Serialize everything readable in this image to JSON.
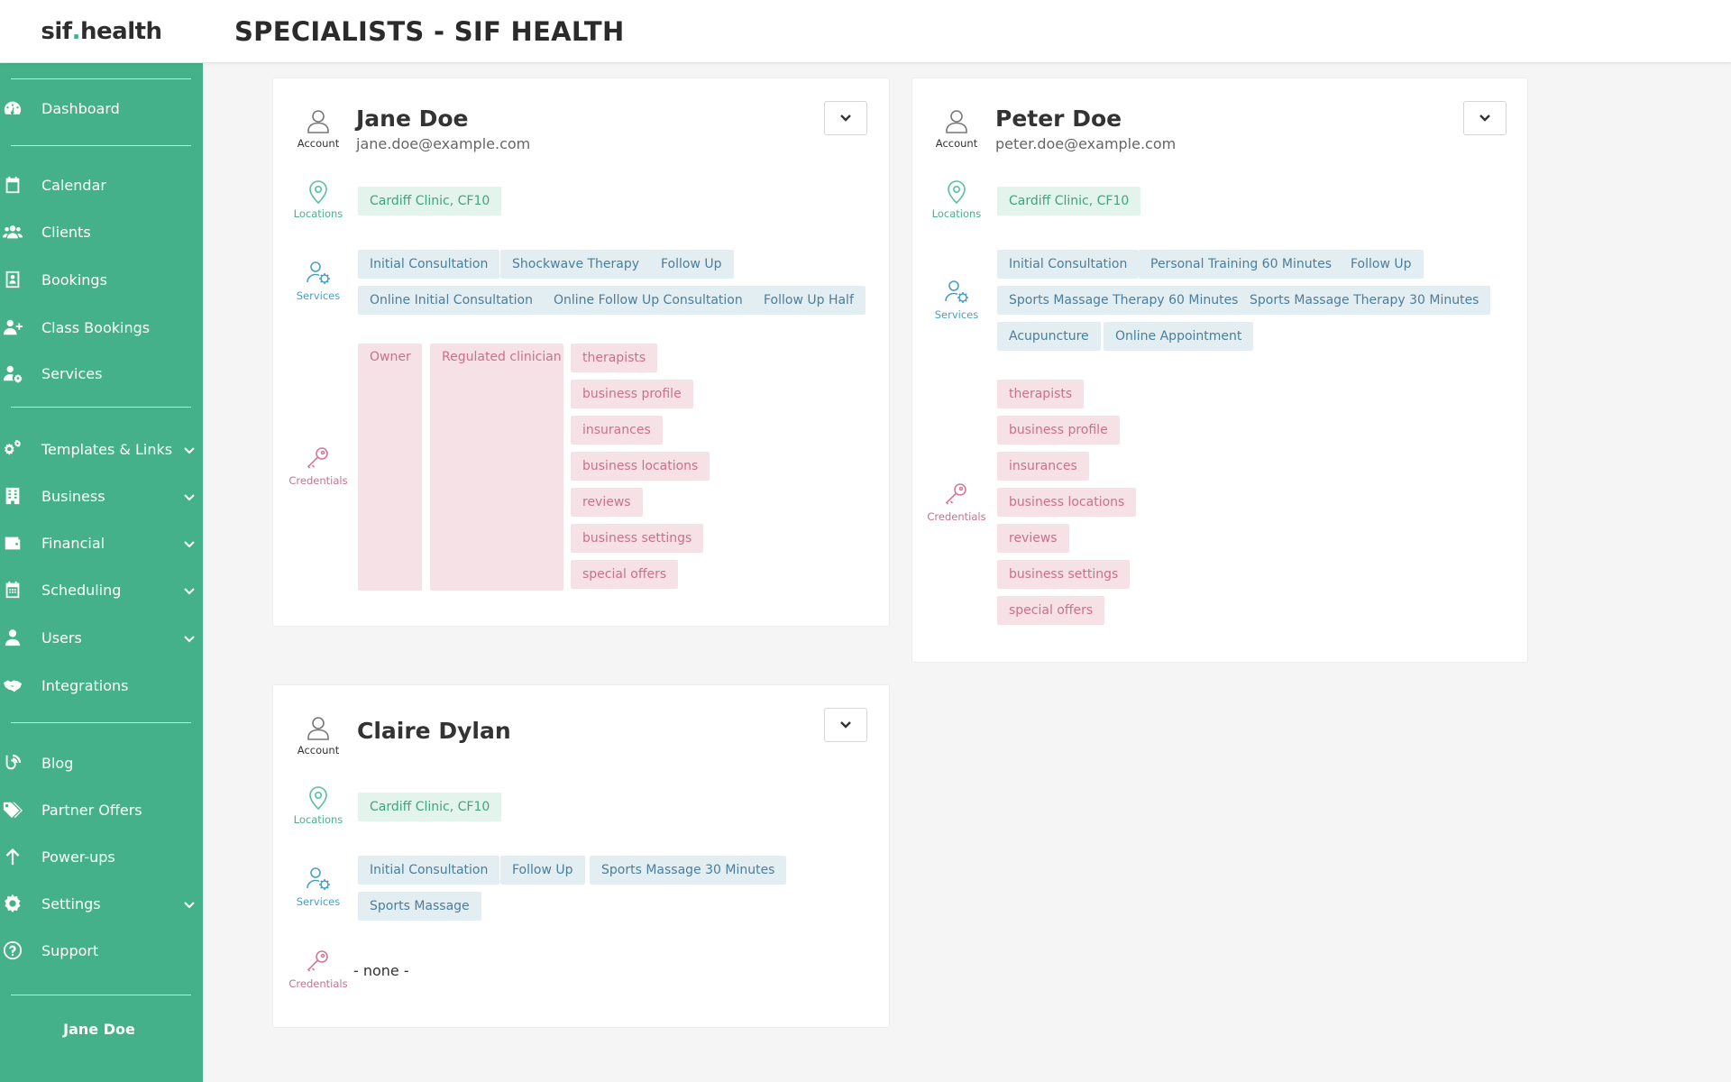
{
  "app": {
    "logo_left": "sif",
    "logo_dot": ".",
    "logo_right": "health",
    "page_title": "SPECIALISTS - SIF HEALTH",
    "accent_color": "#45b18b"
  },
  "sidebar": {
    "items": [
      {
        "label": "Dashboard",
        "icon": "dashboard-icon"
      },
      {
        "label": "Calendar",
        "icon": "calendar-icon"
      },
      {
        "label": "Clients",
        "icon": "users-icon"
      },
      {
        "label": "Bookings",
        "icon": "bookings-icon"
      },
      {
        "label": "Class Bookings",
        "icon": "user-plus-icon"
      },
      {
        "label": "Services",
        "icon": "user-gear-icon"
      },
      {
        "label": "Templates & Links",
        "icon": "gears-icon"
      },
      {
        "label": "Business",
        "icon": "building-icon"
      },
      {
        "label": "Financial",
        "icon": "wallet-icon"
      },
      {
        "label": "Scheduling",
        "icon": "calendar-grid-icon"
      },
      {
        "label": "Users",
        "icon": "user-tie-icon"
      },
      {
        "label": "Integrations",
        "icon": "handshake-icon"
      },
      {
        "label": "Blog",
        "icon": "blog-icon"
      },
      {
        "label": "Partner Offers",
        "icon": "tags-icon"
      },
      {
        "label": "Power-ups",
        "icon": "arrow-up-icon"
      },
      {
        "label": "Settings",
        "icon": "gear-icon"
      },
      {
        "label": "Support",
        "icon": "question-circle-icon"
      }
    ],
    "current_user": "Jane Doe"
  },
  "labels": {
    "account": "Account",
    "locations": "Locations",
    "services": "Services",
    "credentials": "Credentials"
  },
  "specialists": [
    {
      "name": "Jane Doe",
      "email": "jane.doe@example.com",
      "locations": [
        "Cardiff Clinic, CF10"
      ],
      "services": [
        "Initial Consultation",
        "Shockwave Therapy",
        "Follow Up",
        "Online Initial Consultation",
        "Online Follow Up Consultation",
        "Follow Up Half"
      ],
      "roles": [
        "Owner",
        "Regulated clinician"
      ],
      "credentials": [
        "therapists",
        "business profile",
        "insurances",
        "business locations",
        "reviews",
        "business settings",
        "special offers"
      ]
    },
    {
      "name": "Peter Doe",
      "email": "peter.doe@example.com",
      "locations": [
        "Cardiff Clinic, CF10"
      ],
      "services": [
        "Initial Consultation",
        "Personal Training 60 Minutes",
        "Follow Up",
        "Sports Massage Therapy 60 Minutes",
        "Sports Massage Therapy 30 Minutes",
        "Acupuncture",
        "Online Appointment"
      ],
      "credentials": [
        "therapists",
        "business profile",
        "insurances",
        "business locations",
        "reviews",
        "business settings",
        "special offers"
      ]
    },
    {
      "name": "Claire Dylan",
      "locations": [
        "Cardiff Clinic, CF10"
      ],
      "services": [
        "Initial Consultation",
        "Follow Up",
        "Sports Massage 30 Minutes",
        "Sports Massage"
      ],
      "credentials_empty": "- none -"
    }
  ]
}
